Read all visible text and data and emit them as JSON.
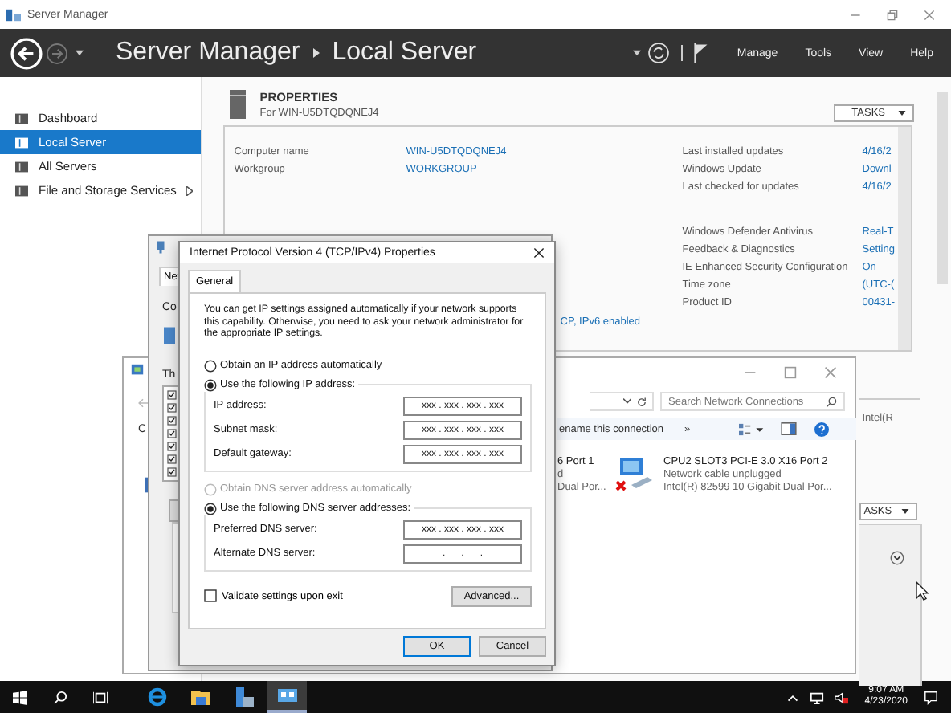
{
  "window": {
    "title": "Server Manager"
  },
  "header": {
    "breadcrumb": [
      "Server Manager",
      "Local Server"
    ],
    "menu": [
      "Manage",
      "Tools",
      "View",
      "Help"
    ]
  },
  "sidebar": {
    "items": [
      {
        "label": "Dashboard",
        "selected": false,
        "expandable": false
      },
      {
        "label": "Local Server",
        "selected": true,
        "expandable": false
      },
      {
        "label": "All Servers",
        "selected": false,
        "expandable": false
      },
      {
        "label": "File and Storage Services",
        "selected": false,
        "expandable": true
      }
    ]
  },
  "properties": {
    "title": "PROPERTIES",
    "subtitle": "For WIN-U5DTQDQNEJ4",
    "tasks": "TASKS",
    "left": [
      {
        "label": "Computer name",
        "value": "WIN-U5DTQDQNEJ4"
      },
      {
        "label": "Workgroup",
        "value": "WORKGROUP"
      }
    ],
    "left_fragment": "CP, IPv6 enabled",
    "right": [
      [
        {
          "label": "Last installed updates",
          "value": "4/16/2"
        },
        {
          "label": "Windows Update",
          "value": "Downl"
        },
        {
          "label": "Last checked for updates",
          "value": "4/16/2"
        }
      ],
      [
        {
          "label": "Windows Defender Antivirus",
          "value": "Real-T"
        },
        {
          "label": "Feedback & Diagnostics",
          "value": "Setting"
        },
        {
          "label": "IE Enhanced Security Configuration",
          "value": "On"
        },
        {
          "label": "Time zone",
          "value": "(UTC-("
        },
        {
          "label": "Product ID",
          "value": "00431-"
        }
      ]
    ]
  },
  "lower_panel": {
    "text": "Intel(R",
    "tasks": "ASKS"
  },
  "network_connections": {
    "search": {
      "placeholder": "Search Network Connections"
    },
    "left_fragment": "C",
    "toolbar_text": "ename this connection",
    "more": "»",
    "adapters": [
      {
        "kind": "partial",
        "name": "6 Port 1",
        "status": "d",
        "device": "Dual Por..."
      },
      {
        "kind": "full",
        "name": "CPU2 SLOT3 PCI-E 3.0 X16 Port 2",
        "status": "Network cable unplugged",
        "device": "Intel(R) 82599 10 Gigabit Dual Por...",
        "unplugged": true
      }
    ]
  },
  "ethernet_properties": {
    "tab": "Net",
    "texts": [
      "Co",
      "Th"
    ]
  },
  "ipv4": {
    "title": "Internet Protocol Version 4 (TCP/IPv4) Properties",
    "tabs": [
      {
        "label": "General",
        "selected": true
      }
    ],
    "intro": "You can get IP settings assigned automatically if your network supports this capability. Otherwise, you need to ask your network administrator for the appropriate IP settings.",
    "ip_mode": [
      {
        "label": "Obtain an IP address automatically",
        "selected": false,
        "disabled": false
      },
      {
        "label": "Use the following IP address:",
        "selected": true,
        "disabled": false
      }
    ],
    "ip_fields": [
      {
        "label": "IP address:",
        "value": "xxx . xxx . xxx . xxx"
      },
      {
        "label": "Subnet mask:",
        "value": "xxx . xxx . xxx . xxx"
      },
      {
        "label": "Default gateway:",
        "value": "xxx . xxx . xxx . xxx"
      }
    ],
    "dns_mode": [
      {
        "label": "Obtain DNS server address automatically",
        "selected": false,
        "disabled": true
      },
      {
        "label": "Use the following DNS server addresses:",
        "selected": true,
        "disabled": false
      }
    ],
    "dns_fields": [
      {
        "label": "Preferred DNS server:",
        "value": "xxx . xxx . xxx . xxx"
      },
      {
        "label": "Alternate DNS server:",
        "value": ".      .      ."
      }
    ],
    "validate": {
      "label": "Validate settings upon exit",
      "checked": false
    },
    "advanced": "Advanced...",
    "buttons": [
      "OK",
      "Cancel"
    ]
  },
  "taskbar": {
    "apps": [
      {
        "kind": "browser",
        "active": false
      },
      {
        "kind": "folder",
        "active": false
      },
      {
        "kind": "server",
        "active": false
      },
      {
        "kind": "network",
        "active": true
      }
    ],
    "time": "9:07 AM",
    "date": "4/23/2020"
  }
}
